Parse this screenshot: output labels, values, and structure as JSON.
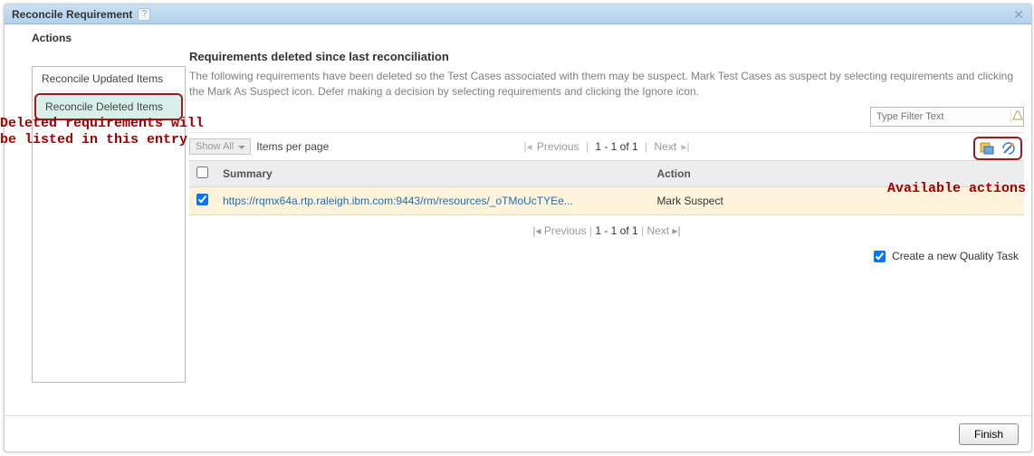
{
  "dialog": {
    "title": "Reconcile Requirement"
  },
  "actions": {
    "label": "Actions",
    "tabs": [
      {
        "label": "Reconcile Updated Items"
      },
      {
        "label": "Reconcile Deleted Items"
      }
    ]
  },
  "panel": {
    "heading": "Requirements deleted since last reconciliation",
    "description": "The following requirements have been deleted so the Test Cases associated with them may be suspect. Mark Test Cases as suspect by selecting requirements and clicking the Mark As Suspect icon. Defer making a decision by selecting requirements and clicking the Ignore icon."
  },
  "filter": {
    "placeholder": "Type Filter Text"
  },
  "toolbar": {
    "showAll": "Show All",
    "itemsPerPage": "Items per page"
  },
  "pager": {
    "prev": "Previous",
    "next": "Next",
    "range": "1 - 1 of 1"
  },
  "table": {
    "headers": {
      "summary": "Summary",
      "action": "Action"
    },
    "rows": [
      {
        "checked": true,
        "summary": "https://rqmx64a.rtp.raleigh.ibm.com:9443/rm/resources/_oTMoUcTYEe...",
        "action": "Mark Suspect"
      }
    ]
  },
  "qualityTask": {
    "label": "Create a new Quality Task",
    "checked": true
  },
  "footer": {
    "finish": "Finish"
  },
  "annotations": {
    "deleted1": "Deleted requirements will",
    "deleted2": " be listed in this entry",
    "available": "Available actions"
  }
}
